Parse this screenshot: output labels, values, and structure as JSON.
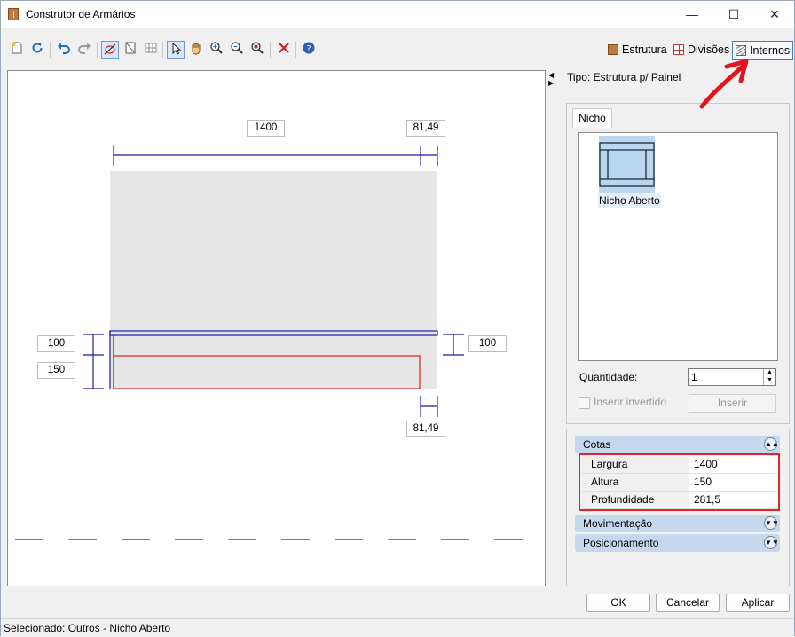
{
  "window": {
    "title": "Construtor de Armários",
    "minimize": "—",
    "maximize": "☐",
    "close": "✕"
  },
  "toolbar": {
    "tools": [
      "new-icon",
      "refresh-icon",
      "undo-icon",
      "redo-icon",
      "measure-icon",
      "door-icon",
      "grid-icon",
      "pointer-icon",
      "pan-hand-icon",
      "zoom-in-icon",
      "zoom-out-icon",
      "zoom-fit-icon",
      "delete-icon",
      "help-icon"
    ],
    "estrutura_label": "Estrutura",
    "divisoes_label": "Divisões",
    "internos_label": "Internos"
  },
  "canvas": {
    "dims": {
      "top_width": "1400",
      "top_right": "81,49",
      "left_top": "100",
      "left_bottom": "150",
      "right": "100",
      "bottom_right": "81,49"
    }
  },
  "panel": {
    "tipo": "Tipo: Estrutura p/ Painel",
    "tab": "Nicho",
    "items": [
      {
        "label": "Nicho Aberto"
      }
    ],
    "quantidade_label": "Quantidade:",
    "quantidade_value": "1",
    "inserir_invertido": "Inserir invertido",
    "inserir_button": "Inserir"
  },
  "properties": {
    "cotas_label": "Cotas",
    "rows": [
      {
        "name": "Largura",
        "value": "1400"
      },
      {
        "name": "Altura",
        "value": "150"
      },
      {
        "name": "Profundidade",
        "value": "281,5"
      }
    ],
    "movimentacao_label": "Movimentação",
    "posicionamento_label": "Posicionamento"
  },
  "buttons": {
    "ok": "OK",
    "cancel": "Cancelar",
    "apply": "Aplicar"
  },
  "status": "Selecionado: Outros - Nicho Aberto",
  "colors": {
    "accent": "#3c7fc0",
    "dimension_line": "#1a1aa8",
    "selection": "#d42020",
    "highlight": "#e3232c",
    "arrow": "#e3141c"
  }
}
